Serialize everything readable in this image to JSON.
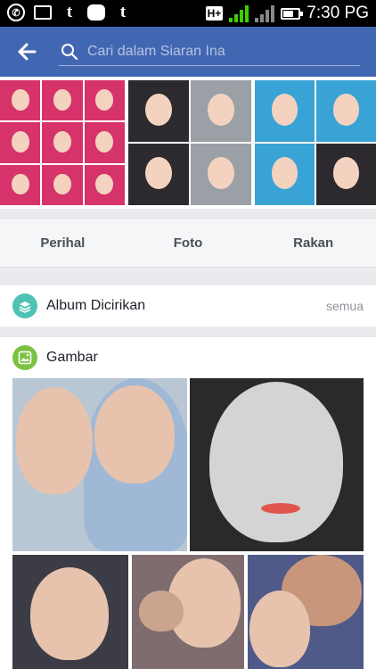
{
  "status_bar": {
    "network": "H+",
    "time": "7:30 PG",
    "notification_icons": [
      "whatsapp-icon",
      "gallery-icon",
      "tumblr-icon",
      "messenger-icon",
      "tumblr-icon"
    ]
  },
  "app_bar": {
    "search_placeholder": "Cari dalam Siaran Ina",
    "colors": {
      "bar": "#4267b2"
    }
  },
  "tabs": [
    {
      "label": "Perihal"
    },
    {
      "label": "Foto"
    },
    {
      "label": "Rakan"
    }
  ],
  "album_section": {
    "title": "Album Dicirikan",
    "see_all": "semua",
    "icon": "album-stack-icon"
  },
  "gambar_section": {
    "title": "Gambar",
    "icon": "photo-icon",
    "photo_count": 5
  }
}
